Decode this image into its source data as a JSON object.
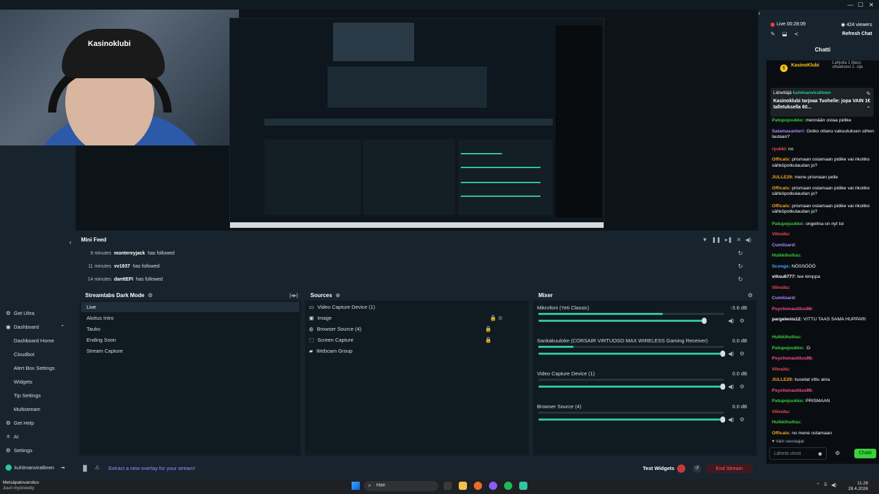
{
  "window": {
    "controls": [
      "—",
      "☐",
      "✕"
    ]
  },
  "preview": {
    "webcam_logo": "Kasinoklubi"
  },
  "sidebar": {
    "items": [
      {
        "label": "Get Ultra",
        "icon": "ultra-icon"
      },
      {
        "label": "Dashboard",
        "icon": "dashboard-icon"
      },
      {
        "label": "Dashboard Home",
        "sub": true
      },
      {
        "label": "Cloudbot",
        "sub": true
      },
      {
        "label": "Alert Box Settings",
        "sub": true
      },
      {
        "label": "Widgets",
        "sub": true
      },
      {
        "label": "Tip Settings",
        "sub": true
      },
      {
        "label": "Multistream",
        "sub": true
      },
      {
        "label": "Get Help",
        "icon": "help-icon"
      },
      {
        "label": "AI",
        "icon": "ai-icon"
      },
      {
        "label": "Settings",
        "icon": "gear-icon"
      }
    ],
    "account": "kuhlmanvirallinen"
  },
  "minifeed": {
    "title": "Mini Feed",
    "rows": [
      {
        "time": "9 minutes",
        "user": "montereyjack",
        "action": "has followed"
      },
      {
        "time": "11 minutes",
        "user": "vv1937",
        "action": "has followed"
      },
      {
        "time": "14 minutes",
        "user": "danttEFI",
        "action": "has followed"
      }
    ]
  },
  "scenes": {
    "title": "Streamlabs Dark Mode",
    "items": [
      "Live",
      "Aloitus Intro",
      "Tauko",
      "Ending Soon",
      "Stream Capture"
    ],
    "active": 0
  },
  "sources": {
    "title": "Sources",
    "items": [
      {
        "label": "Video Capture Device (1)",
        "icon": "▭"
      },
      {
        "label": "Image",
        "icon": "▣"
      },
      {
        "label": "Browser Source (4)",
        "icon": "◍"
      },
      {
        "label": "Screen Capture",
        "icon": "⬚"
      },
      {
        "label": "Webcam Group",
        "icon": "▰"
      }
    ]
  },
  "mixer": {
    "title": "Mixer",
    "items": [
      {
        "name": "Mikrofoni (Yeti Classic)",
        "db": "-3.6 dB",
        "level": 0.67,
        "volume": 0.9
      },
      {
        "name": "Sankakuuloke (CORSAIR VIRTUOSO MAX WIRELESS Gaming Receiver)",
        "db": "0.0 dB",
        "level": 0.19,
        "volume": 1.0
      },
      {
        "name": "Video Capture Device (1)",
        "db": "0.0 dB",
        "level": 0,
        "volume": 1.0
      },
      {
        "name": "Browser Source (4)",
        "db": "0.0 dB",
        "level": 0,
        "volume": 1.0
      }
    ]
  },
  "bottombar": {
    "overlay_link": "Extract a new overlay for your stream!",
    "test_widgets": "Test Widgets",
    "end_stream": "End Stream"
  },
  "chat": {
    "live": "Live 00:28:09",
    "viewers": "424 viewers",
    "refresh": "Refresh Chat",
    "title": "Chatti",
    "pinned_name": "KasinoKlubi",
    "pinned_count": "6",
    "pinned_text": "Lahjoita 1 tilaus ottaaksesi 2. sija",
    "announce_sender_prefix": "Lähettäjä",
    "announce_sender": "kuhlmanvirallinen",
    "announce_msg": "Kasinoklubi tarjoaa Tuohelle: jopa VAIN 1€ talletuksella 60...",
    "messages": [
      {
        "name": "Patupojuukko:",
        "color": "#3ad13a",
        "text": " mennään ostaa pidike"
      },
      {
        "name": "Salamasanteri:",
        "color": "#b48cff",
        "text": " Ootko ottanu vakuutuksen siihen lautaan?"
      },
      {
        "name": "ryukki",
        "color": "#ff4d4d",
        "text": ": no"
      },
      {
        "name": "Officals:",
        "color": "#f5a623",
        "text": " prismaan ostamaan pidike vai rikoitko sähköpotkulaudan jo?"
      },
      {
        "name": "JULLE29:",
        "color": "#f5a623",
        "text": " mene prismaan pelle"
      },
      {
        "name": "Officals:",
        "color": "#f5a623",
        "text": " prismaan ostamaan pidike vai rikoitko sähköpotkulaudan jo?"
      },
      {
        "name": "Officals:",
        "color": "#f5a623",
        "text": " prismaan ostamaan pidike vai rikoitko sähköpotkulaudan jo?"
      },
      {
        "name": "Patupojuukko:",
        "color": "#3ad13a",
        "text": " ongelma on nyt toi"
      },
      {
        "name": "Vilnsitu:",
        "color": "#ff4d4d",
        "text": ""
      },
      {
        "name": "Cumlizard:",
        "color": "#b48cff",
        "text": ""
      },
      {
        "name": "Hulkkihulluu:",
        "color": "#3ad13a",
        "text": ""
      },
      {
        "name": "Scongs:",
        "color": "#4da6ff",
        "text": " NÖSSÖÖÖ"
      },
      {
        "name": "viitsu6777:",
        "color": "#ffffff",
        "text": " tee kimppa"
      },
      {
        "name": "Vilnsitu:",
        "color": "#ff4d4d",
        "text": ""
      },
      {
        "name": "Cumlizard:",
        "color": "#b48cff",
        "text": ""
      },
      {
        "name": "Psychonautilus98:",
        "color": "#ff4d8d",
        "text": ""
      },
      {
        "name": "pargelenis12:",
        "color": "#ffffff",
        "text": " VITTU TAAS SAMA HUPPARI"
      },
      {
        "name": "Hulkkihulluu:",
        "color": "#3ad13a",
        "text": ""
      },
      {
        "name": "Patupojuukko:",
        "color": "#3ad13a",
        "text": " :D"
      },
      {
        "name": "Psychonautilus98:",
        "color": "#ff4d8d",
        "text": ""
      },
      {
        "name": "Vilnsitu:",
        "color": "#ff4d4d",
        "text": ""
      },
      {
        "name": "JULLE29:",
        "color": "#f5a623",
        "text": " kusetat vittu aina"
      },
      {
        "name": "Psychonautilus98:",
        "color": "#ff4d8d",
        "text": ""
      },
      {
        "name": "Patupojuukko:",
        "color": "#3ad13a",
        "text": " PRISMAAN"
      },
      {
        "name": "Vilnsitu:",
        "color": "#ff4d4d",
        "text": ""
      },
      {
        "name": "Hulkkihulluu:",
        "color": "#3ad13a",
        "text": ""
      },
      {
        "name": "Officals:",
        "color": "#f5a623",
        "text": " no mene ostamaan"
      }
    ],
    "followers_only": "Vain seuraajat",
    "input_placeholder": "Lähetä viesti",
    "send": "Chatti"
  },
  "taskbar": {
    "weather_title": "Metsäpalovaroitus",
    "weather_sub": "Juuri myönnetty",
    "search": "Hae",
    "time": "11.28",
    "date": "28.4.2026"
  }
}
